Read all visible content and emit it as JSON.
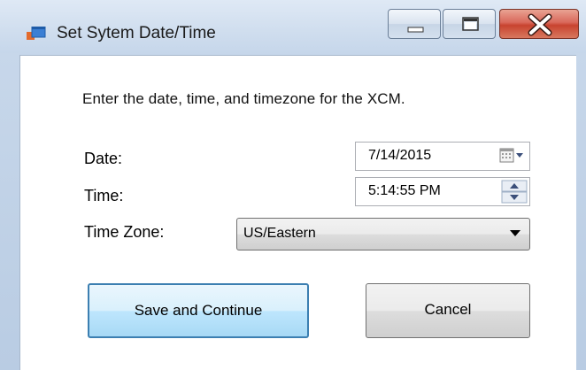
{
  "window": {
    "title": "Set Sytem Date/Time"
  },
  "dialog": {
    "instruction": "Enter the date, time, and timezone for the XCM.",
    "date": {
      "label": "Date:",
      "value": "7/14/2015"
    },
    "time": {
      "label": "Time:",
      "value": "5:14:55 PM"
    },
    "timezone": {
      "label": "Time Zone:",
      "value": "US/Eastern"
    }
  },
  "buttons": {
    "save_label": "Save and Continue",
    "cancel_label": "Cancel"
  },
  "icons": {
    "app": "app-window-icon",
    "minimize": "minimize-icon",
    "maximize": "maximize-icon",
    "close": "close-icon",
    "calendar": "calendar-icon",
    "spinner": "spinner-arrows-icon",
    "dropdown": "chevron-down-icon"
  },
  "colors": {
    "close_button": "#c8432f",
    "focus_border": "#3c7fb1"
  }
}
